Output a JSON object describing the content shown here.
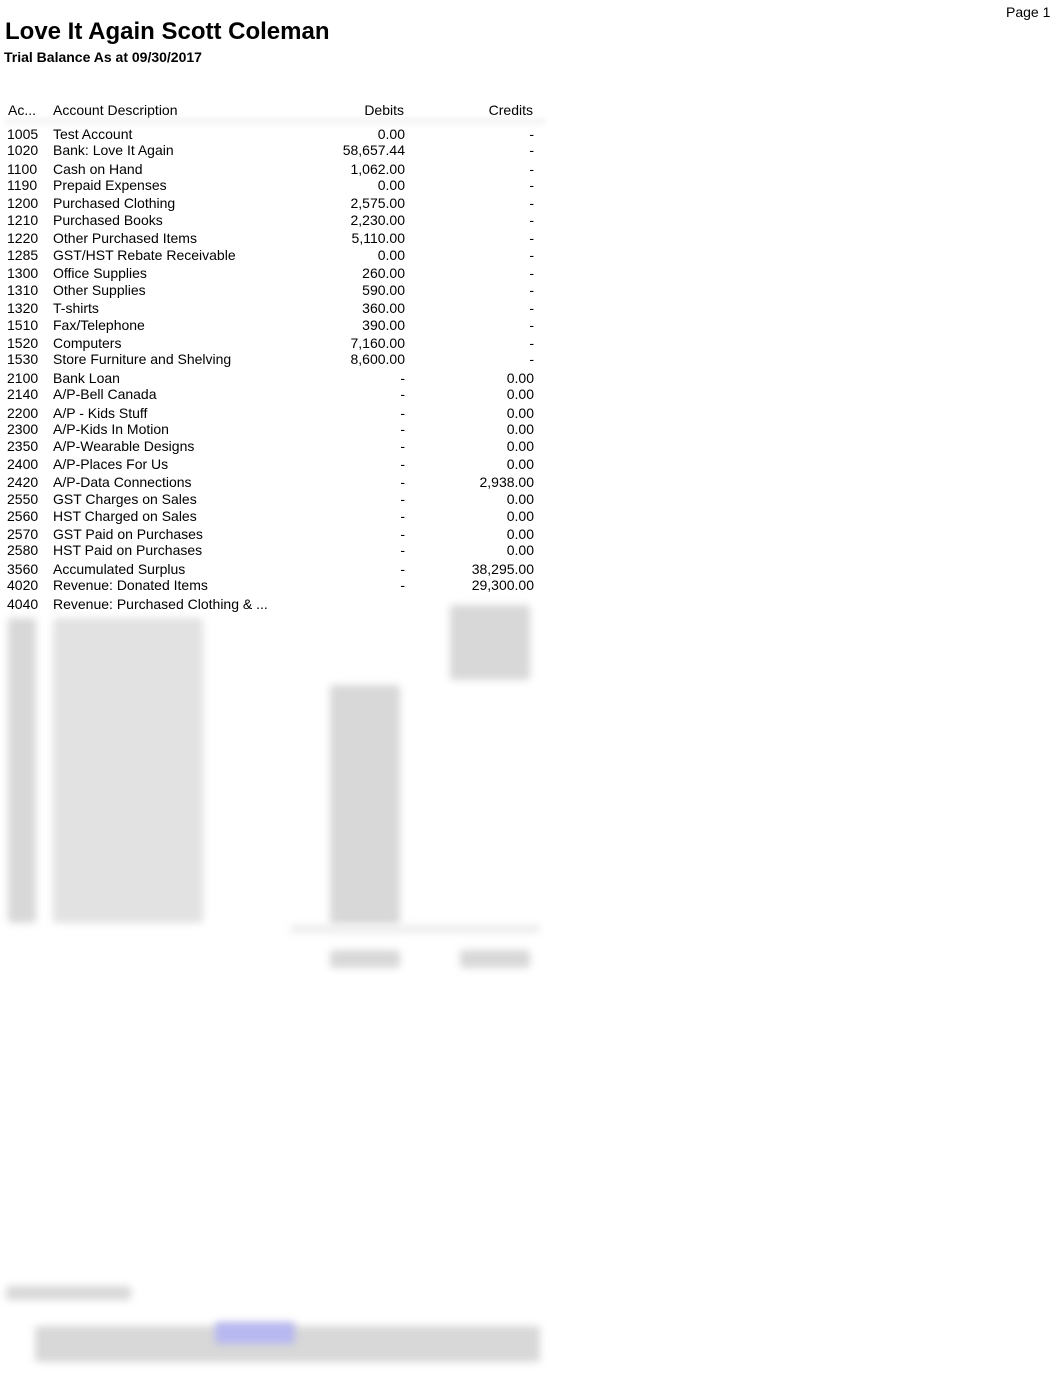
{
  "page": {
    "label": "Page 1"
  },
  "report": {
    "company": "Love It Again Scott Coleman",
    "subtitle": "Trial Balance As at 09/30/2017"
  },
  "table": {
    "headers": {
      "account": "Ac...",
      "description": "Account Description",
      "debits": "Debits",
      "credits": "Credits"
    },
    "rows": [
      {
        "account": "1005",
        "description": "Test Account",
        "debits": "0.00",
        "credits": "-"
      },
      {
        "account": "1020",
        "description": "Bank: Love It Again",
        "debits": "58,657.44",
        "credits": "-"
      },
      {
        "account": "1100",
        "description": "Cash on Hand",
        "debits": "1,062.00",
        "credits": "-"
      },
      {
        "account": "1190",
        "description": "Prepaid Expenses",
        "debits": "0.00",
        "credits": "-"
      },
      {
        "account": "1200",
        "description": "Purchased Clothing",
        "debits": "2,575.00",
        "credits": "-"
      },
      {
        "account": "1210",
        "description": "Purchased Books",
        "debits": "2,230.00",
        "credits": "-"
      },
      {
        "account": "1220",
        "description": "Other Purchased Items",
        "debits": "5,110.00",
        "credits": "-"
      },
      {
        "account": "1285",
        "description": "GST/HST Rebate Receivable",
        "debits": "0.00",
        "credits": "-"
      },
      {
        "account": "1300",
        "description": "Office Supplies",
        "debits": "260.00",
        "credits": "-"
      },
      {
        "account": "1310",
        "description": "Other Supplies",
        "debits": "590.00",
        "credits": "-"
      },
      {
        "account": "1320",
        "description": "T-shirts",
        "debits": "360.00",
        "credits": "-"
      },
      {
        "account": "1510",
        "description": "Fax/Telephone",
        "debits": "390.00",
        "credits": "-"
      },
      {
        "account": "1520",
        "description": "Computers",
        "debits": "7,160.00",
        "credits": "-"
      },
      {
        "account": "1530",
        "description": "Store Furniture and Shelving",
        "debits": "8,600.00",
        "credits": "-"
      },
      {
        "account": "2100",
        "description": "Bank Loan",
        "debits": "-",
        "credits": "0.00"
      },
      {
        "account": "2140",
        "description": "A/P-Bell Canada",
        "debits": "-",
        "credits": "0.00"
      },
      {
        "account": "2200",
        "description": "A/P - Kids Stuff",
        "debits": "-",
        "credits": "0.00"
      },
      {
        "account": "2300",
        "description": "A/P-Kids In Motion",
        "debits": "-",
        "credits": "0.00"
      },
      {
        "account": "2350",
        "description": "A/P-Wearable Designs",
        "debits": "-",
        "credits": "0.00"
      },
      {
        "account": "2400",
        "description": "A/P-Places For Us",
        "debits": "-",
        "credits": "0.00"
      },
      {
        "account": "2420",
        "description": "A/P-Data Connections",
        "debits": "-",
        "credits": "2,938.00"
      },
      {
        "account": "2550",
        "description": "GST Charges on Sales",
        "debits": "-",
        "credits": "0.00"
      },
      {
        "account": "2560",
        "description": "HST Charged on Sales",
        "debits": "-",
        "credits": "0.00"
      },
      {
        "account": "2570",
        "description": "GST Paid on Purchases",
        "debits": "-",
        "credits": "0.00"
      },
      {
        "account": "2580",
        "description": "HST Paid on Purchases",
        "debits": "-",
        "credits": "0.00"
      },
      {
        "account": "3560",
        "description": "Accumulated Surplus",
        "debits": "-",
        "credits": "38,295.00"
      },
      {
        "account": "4020",
        "description": "Revenue: Donated Items",
        "debits": "-",
        "credits": "29,300.00"
      },
      {
        "account": "4040",
        "description": "Revenue: Purchased Clothing & ...",
        "debits": "",
        "credits": ""
      }
    ]
  },
  "colors": {
    "text": "#000000",
    "blur": "#d8d8d8",
    "blur_link": "#b8b8f0"
  }
}
